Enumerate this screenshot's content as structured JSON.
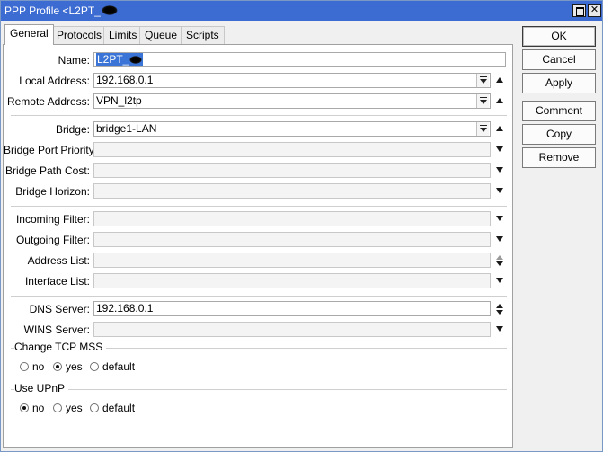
{
  "window": {
    "title": "PPP Profile <L2PT_",
    "maximize_icon": "maximize-icon",
    "close_icon": "close-icon",
    "close_glyph": "✕",
    "title_color": "#3c6bd2"
  },
  "tabs": [
    {
      "label": "General",
      "active": true
    },
    {
      "label": "Protocols"
    },
    {
      "label": "Limits"
    },
    {
      "label": "Queue"
    },
    {
      "label": "Scripts"
    }
  ],
  "fields": {
    "name": {
      "label": "Name:",
      "value": "L2PT_"
    },
    "local_address": {
      "label": "Local Address:",
      "value": "192.168.0.1"
    },
    "remote_address": {
      "label": "Remote Address:",
      "value": "VPN_l2tp"
    },
    "bridge": {
      "label": "Bridge:",
      "value": "bridge1-LAN"
    },
    "bridge_port_priority": {
      "label": "Bridge Port Priority:",
      "value": ""
    },
    "bridge_path_cost": {
      "label": "Bridge Path Cost:",
      "value": ""
    },
    "bridge_horizon": {
      "label": "Bridge Horizon:",
      "value": ""
    },
    "incoming_filter": {
      "label": "Incoming Filter:",
      "value": ""
    },
    "outgoing_filter": {
      "label": "Outgoing Filter:",
      "value": ""
    },
    "address_list": {
      "label": "Address List:",
      "value": ""
    },
    "interface_list": {
      "label": "Interface List:",
      "value": ""
    },
    "dns_server": {
      "label": "DNS Server:",
      "value": "192.168.0.1"
    },
    "wins_server": {
      "label": "WINS Server:",
      "value": ""
    }
  },
  "change_tcp_mss": {
    "title": "Change TCP MSS",
    "options": [
      "no",
      "yes",
      "default"
    ],
    "selected": "yes"
  },
  "use_upnp": {
    "title": "Use UPnP",
    "options": [
      "no",
      "yes",
      "default"
    ],
    "selected": "no"
  },
  "buttons": {
    "ok": "OK",
    "cancel": "Cancel",
    "apply": "Apply",
    "comment": "Comment",
    "copy": "Copy",
    "remove": "Remove"
  }
}
